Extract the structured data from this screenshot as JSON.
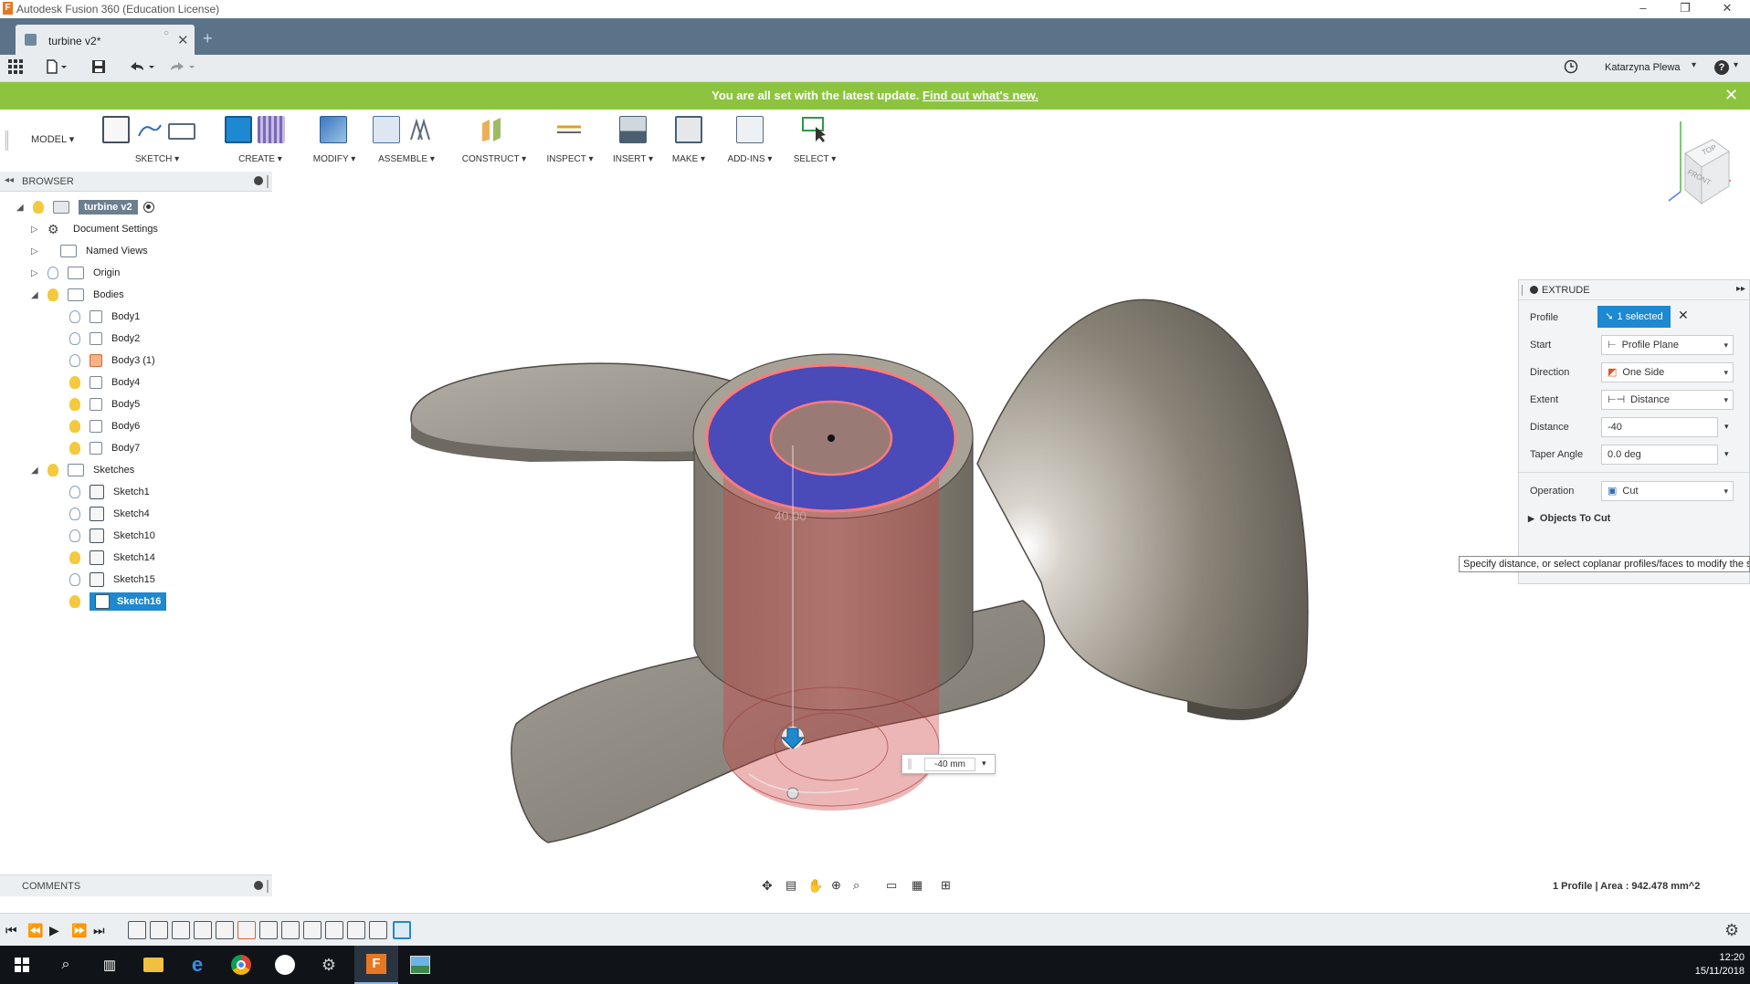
{
  "window": {
    "title": "Autodesk Fusion 360 (Education License)",
    "controls": [
      "–",
      "❐",
      "✕"
    ]
  },
  "tabs": {
    "active_label": "turbine v2*",
    "dot": "○",
    "close": "✕",
    "new": "+"
  },
  "qat": {
    "user": "Katarzyna Plewa",
    "help": "?"
  },
  "banner": {
    "message": "You are all set with the latest update.",
    "link": "Find out what's new.",
    "close": "✕"
  },
  "toolbar": {
    "workspace": "MODEL",
    "groups": [
      {
        "label": "SKETCH",
        "colors": [
          "#4a6fa5",
          "#2f6fb0",
          "#5a6a7a"
        ]
      },
      {
        "label": "CREATE",
        "colors": [
          "#1e88d0",
          "#7b68b5"
        ]
      },
      {
        "label": "MODIFY",
        "colors": [
          "#3a78c0"
        ]
      },
      {
        "label": "ASSEMBLE",
        "colors": [
          "#4a6fa5",
          "#5a6a7a"
        ]
      },
      {
        "label": "CONSTRUCT",
        "colors": [
          "#e8a23a"
        ]
      },
      {
        "label": "INSPECT",
        "colors": [
          "#e0a020"
        ]
      },
      {
        "label": "INSERT",
        "colors": [
          "#4a6070"
        ]
      },
      {
        "label": "MAKE",
        "colors": [
          "#4a6070"
        ]
      },
      {
        "label": "ADD-INS",
        "colors": [
          "#5a6a7a"
        ]
      },
      {
        "label": "SELECT",
        "colors": [
          "#2f9a4a"
        ]
      }
    ]
  },
  "browser": {
    "title": "BROWSER",
    "root": "turbine v2",
    "items": [
      {
        "label": "Document Settings",
        "icon": "gear-icon"
      },
      {
        "label": "Named Views",
        "icon": "folder-icon"
      },
      {
        "label": "Origin",
        "icon": "folder-icon"
      },
      {
        "label": "Bodies",
        "icon": "folder-icon"
      }
    ],
    "bodies": [
      "Body1",
      "Body2",
      "Body3 (1)",
      "Body4",
      "Body5",
      "Body6",
      "Body7"
    ],
    "sketches_label": "Sketches",
    "sketches": [
      "Sketch1",
      "Sketch4",
      "Sketch10",
      "Sketch14",
      "Sketch15",
      "Sketch16"
    ]
  },
  "comments": {
    "title": "COMMENTS"
  },
  "viewcube": {
    "top": "TOP",
    "front": "FRONT"
  },
  "viewport": {
    "dimension_label": "40.00",
    "distance_input": "-40 mm"
  },
  "extrude": {
    "title": "EXTRUDE",
    "profile_label": "Profile",
    "profile_value": "1 selected",
    "start_label": "Start",
    "start_value": "Profile Plane",
    "direction_label": "Direction",
    "direction_value": "One Side",
    "extent_label": "Extent",
    "extent_value": "Distance",
    "distance_label": "Distance",
    "distance_value": "-40",
    "taper_label": "Taper Angle",
    "taper_value": "0.0 deg",
    "operation_label": "Operation",
    "operation_value": "Cut",
    "objects_label": "Objects To Cut"
  },
  "tooltip": "Specify distance, or select coplanar profiles/faces to modify the s",
  "status": "1 Profile | Area : 942.478 mm^2",
  "taskbar": {
    "time": "12:20",
    "date": "15/11/2018"
  }
}
